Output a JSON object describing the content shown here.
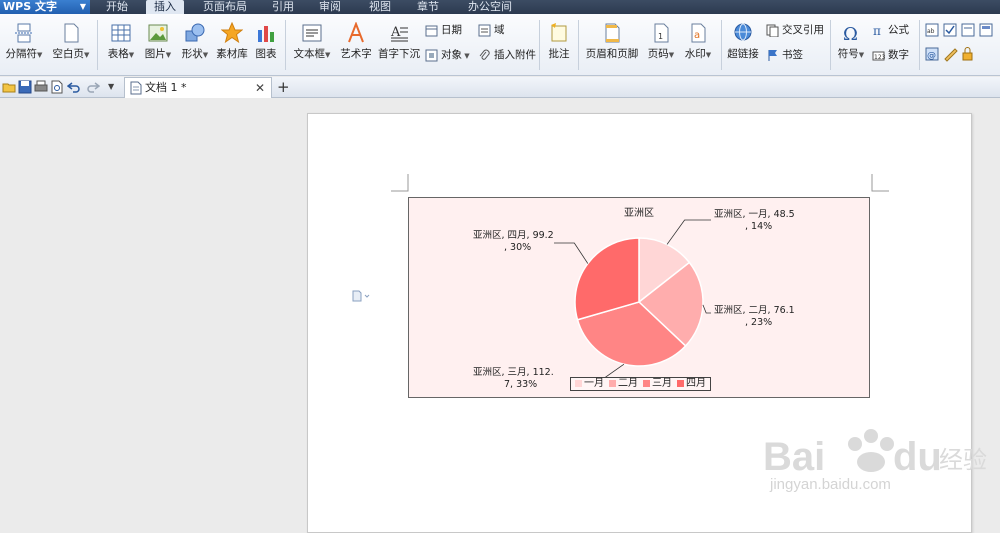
{
  "app": {
    "title": "WPS 文字"
  },
  "menu_tabs": [
    "开始",
    "插入",
    "页面布局",
    "引用",
    "审阅",
    "视图",
    "章节",
    "办公空间"
  ],
  "ribbon": {
    "separator": "分隔符",
    "blank_page": "空白页",
    "table": "表格",
    "picture": "图片",
    "shape": "形状",
    "material": "素材库",
    "chart": "图表",
    "textbox": "文本框",
    "wordart": "艺术字",
    "dropcap": "首字下沉",
    "date": "日期",
    "object": "对象",
    "field": "域",
    "attachment": "插入附件",
    "comment": "批注",
    "header_footer": "页眉和页脚",
    "page_number": "页码",
    "watermark": "水印",
    "hyperlink": "超链接",
    "cross_ref": "交叉引用",
    "bookmark": "书签",
    "symbol": "符号",
    "formula": "公式",
    "number": "数字"
  },
  "document_tab": {
    "name": "文档 1 *"
  },
  "chart_data": {
    "type": "pie",
    "title": "亚洲区",
    "categories": [
      "一月",
      "二月",
      "三月",
      "四月"
    ],
    "values": [
      48.5,
      76.1,
      112.7,
      99.2
    ],
    "percent": [
      "14%",
      "23%",
      "33%",
      "30%"
    ],
    "colors": [
      "#ffd6d6",
      "#ffadad",
      "#ff8585",
      "#ff6a6a"
    ],
    "labels": [
      {
        "line1": "亚洲区, 一月, 48.5",
        "line2": ", 14%"
      },
      {
        "line1": "亚洲区, 二月, 76.1",
        "line2": ", 23%"
      },
      {
        "line1": "亚洲区, 三月, 112.",
        "line2": "7, 33%"
      },
      {
        "line1": "亚洲区, 四月, 99.2",
        "line2": ", 30%"
      }
    ],
    "legend_position": "bottom"
  },
  "watermark": {
    "text": "jingyan.baidu.com"
  }
}
